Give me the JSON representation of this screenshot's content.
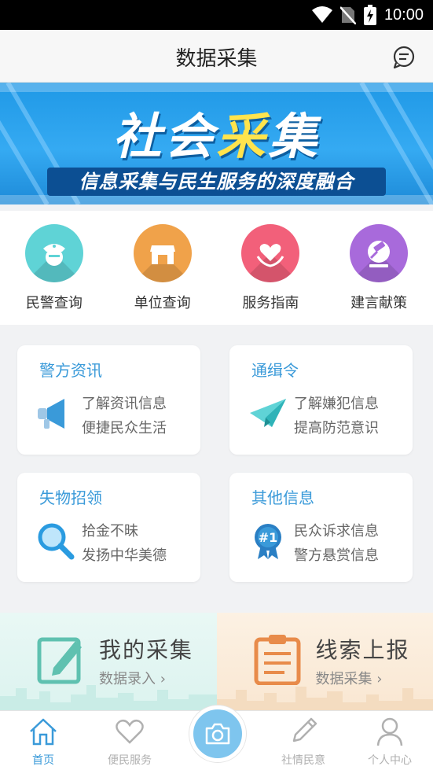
{
  "status_bar": {
    "time": "10:00"
  },
  "header": {
    "title": "数据采集"
  },
  "banner": {
    "title_part1": "社会",
    "title_highlight": "采",
    "title_part2": "集",
    "subtitle": "信息采集与民生服务的深度融合"
  },
  "quick_links": [
    {
      "label": "民警查询",
      "icon": "police-icon",
      "color": "#5fd3d6"
    },
    {
      "label": "单位查询",
      "icon": "store-icon",
      "color": "#f0a24a"
    },
    {
      "label": "服务指南",
      "icon": "heart-hands-icon",
      "color": "#f2607a"
    },
    {
      "label": "建言献策",
      "icon": "gavel-icon",
      "color": "#a86adb"
    }
  ],
  "cards": [
    {
      "title": "警方资讯",
      "line1": "了解资讯信息",
      "line2": "便捷民众生活",
      "icon": "megaphone-icon"
    },
    {
      "title": "通缉令",
      "line1": "了解嫌犯信息",
      "line2": "提高防范意识",
      "icon": "paper-plane-icon"
    },
    {
      "title": "失物招领",
      "line1": "拾金不昧",
      "line2": "发扬中华美德",
      "icon": "magnifier-icon"
    },
    {
      "title": "其他信息",
      "line1": "民众诉求信息",
      "line2": "警方悬赏信息",
      "icon": "badge-icon",
      "badge_text": "#1"
    }
  ],
  "promos": [
    {
      "title": "我的采集",
      "sub": "数据录入 ›",
      "icon": "edit-icon"
    },
    {
      "title": "线索上报",
      "sub": "数据采集 ›",
      "icon": "clipboard-icon"
    }
  ],
  "nav": [
    {
      "label": "首页",
      "icon": "home-icon",
      "active": true
    },
    {
      "label": "便民服务",
      "icon": "heart-icon",
      "active": false
    },
    {
      "label": "社情民意",
      "icon": "pencil-icon",
      "active": false
    },
    {
      "label": "个人中心",
      "icon": "person-icon",
      "active": false
    }
  ],
  "colors": {
    "accent": "#3a9ad9",
    "camera": "#7ec5ee"
  }
}
